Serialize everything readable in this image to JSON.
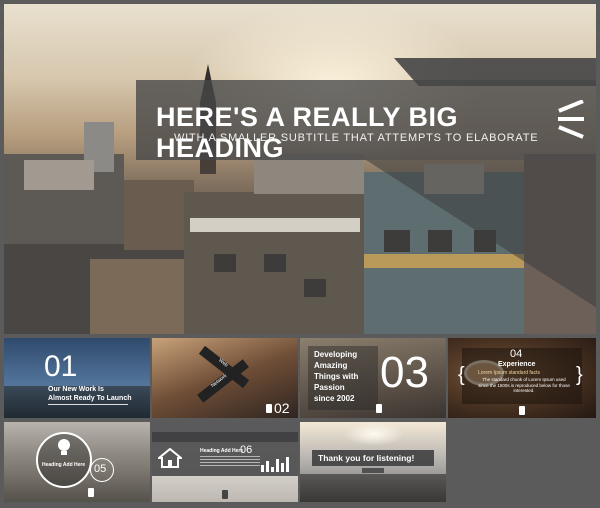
{
  "hero": {
    "title": "HERE'S A REALLY BIG HEADING",
    "subtitle": "WITH A SMALLER SUBTITLE  THAT ATTEMPTS TO ELABORATE"
  },
  "thumbs": {
    "t1": {
      "number": "01",
      "line1": "Our New Work Is",
      "line2": "Almost  Ready To Launch"
    },
    "t2": {
      "number": "02",
      "sign1": "Web",
      "sign2": "Network"
    },
    "t3": {
      "text_lines": [
        "Developing",
        "Amazing",
        "Things with",
        "Passion",
        "since 2002"
      ],
      "number": "03"
    },
    "t4": {
      "number": "04",
      "heading": "Experience",
      "sub": "Lorem Ipsum standard facts",
      "body": "The standard chunk of Lorem Ipsum used since the 1500s is reproduced below for those interested.",
      "brace_left": "{",
      "brace_right": "}"
    },
    "t5": {
      "heading": "Heading Add Here",
      "number": "05"
    },
    "t6": {
      "heading": "Heading Add Here",
      "number": "06"
    },
    "t7": {
      "text": "Thank you for listening!"
    }
  }
}
